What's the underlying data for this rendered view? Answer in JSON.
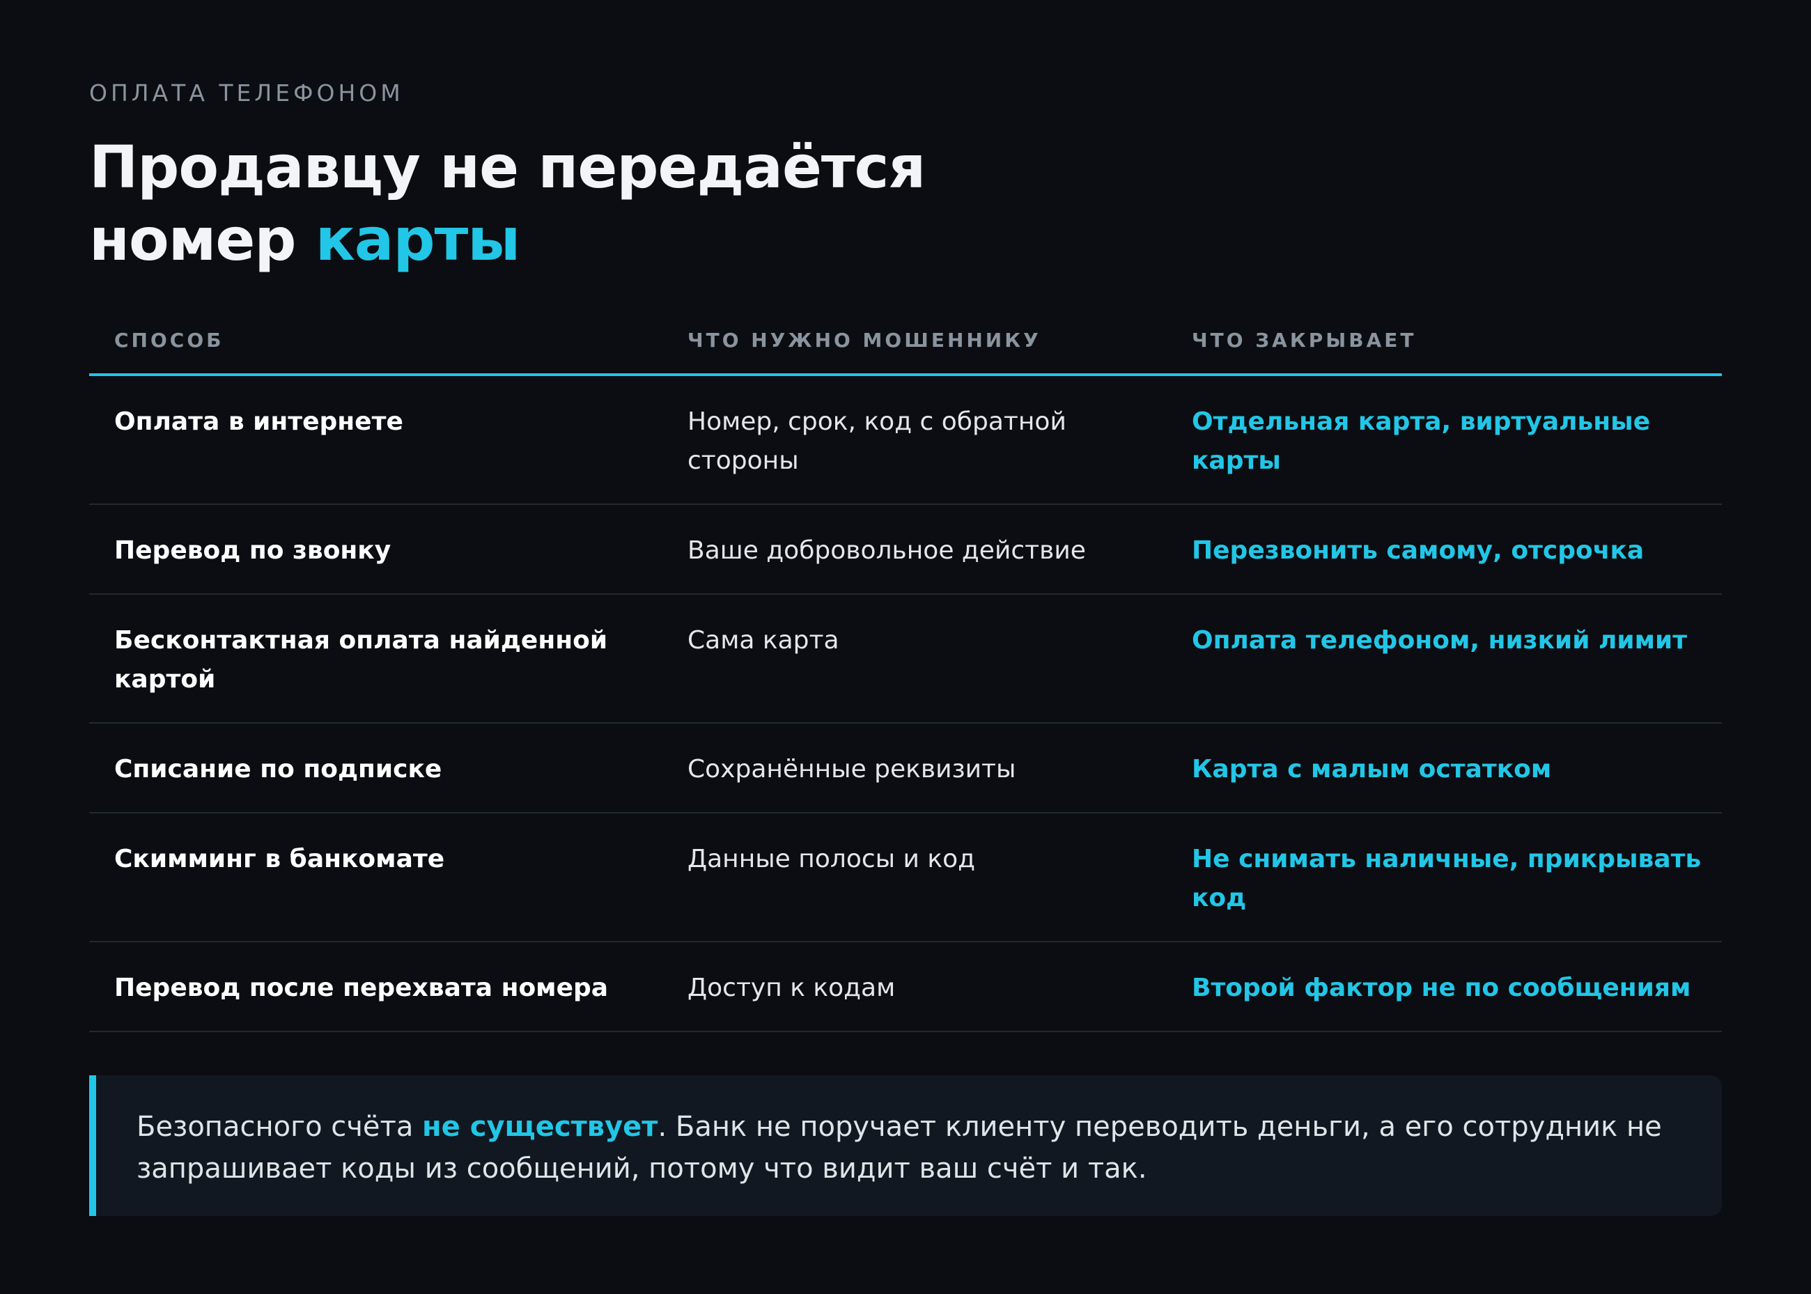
{
  "eyebrow": "ОПЛАТА ТЕЛЕФОНОМ",
  "title": {
    "line1": "Продавцу не передаётся",
    "line2_plain": "номер ",
    "line2_accent": "карты"
  },
  "table": {
    "headers": [
      "СПОСОБ",
      "ЧТО НУЖНО МОШЕННИКУ",
      "ЧТО ЗАКРЫВАЕТ"
    ],
    "rows": [
      {
        "method": "Оплата в интернете",
        "needs": "Номер, срок, код с обратной стороны",
        "protects": "Отдельная карта, виртуальные карты"
      },
      {
        "method": "Перевод по звонку",
        "needs": "Ваше добровольное действие",
        "protects": "Перезвонить самому, отсрочка"
      },
      {
        "method": "Бесконтактная оплата найденной картой",
        "needs": "Сама карта",
        "protects": "Оплата телефоном, низкий лимит"
      },
      {
        "method": "Списание по подписке",
        "needs": "Сохранённые реквизиты",
        "protects": "Карта с малым остатком"
      },
      {
        "method": "Скимминг в банкомате",
        "needs": "Данные полосы и код",
        "protects": "Не снимать наличные, прикрывать код"
      },
      {
        "method": "Перевод после перехвата номера",
        "needs": "Доступ к кодам",
        "protects": "Второй фактор не по сообщениям"
      }
    ]
  },
  "note": {
    "before": "Безопасного счёта ",
    "highlight": "не существует",
    "after": ". Банк не поручает клиенту переводить деньги, а его сотрудник не запрашивает коды из сообщений, потому что видит ваш счёт и так."
  },
  "colors": {
    "background": "#0b0d12",
    "accent": "#22c6e6",
    "muted": "#8a949e",
    "note_background": "#121821"
  }
}
